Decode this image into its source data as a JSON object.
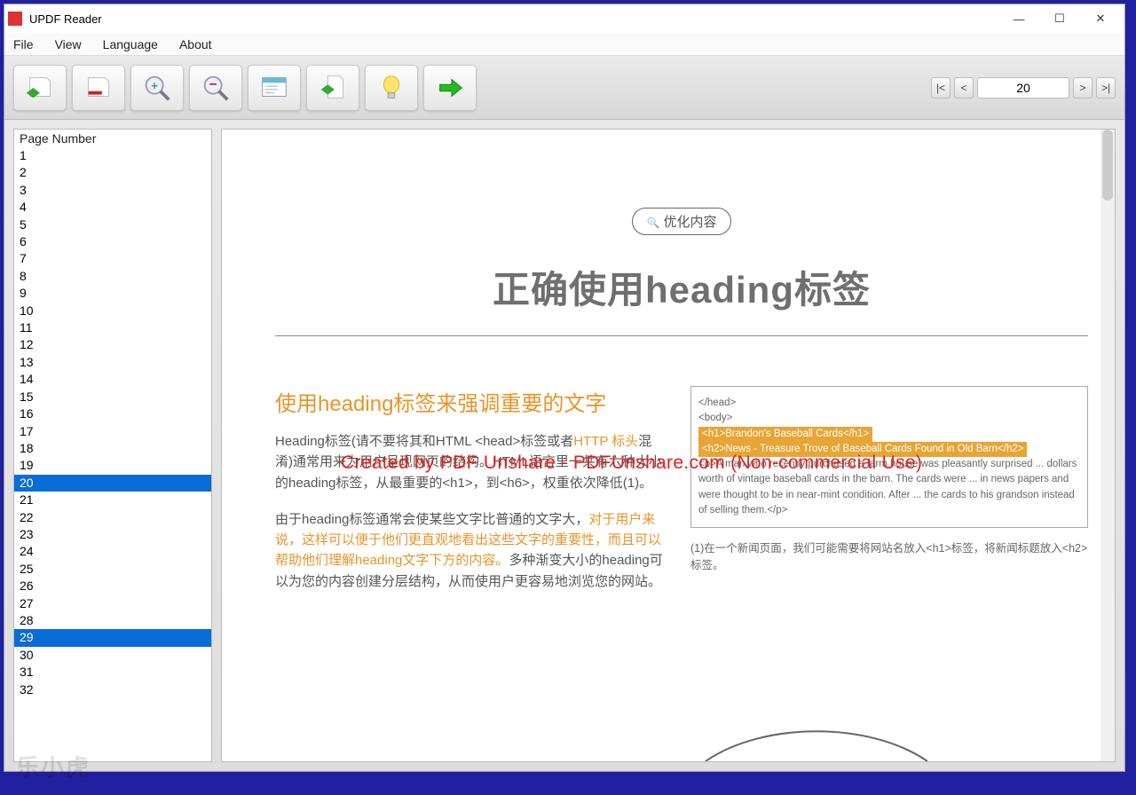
{
  "app": {
    "title": "UPDF Reader"
  },
  "menu": {
    "file": "File",
    "view": "View",
    "language": "Language",
    "about": "About"
  },
  "nav": {
    "first": "|<",
    "prev": "<",
    "page": "20",
    "next": ">",
    "last": ">|"
  },
  "sidebar": {
    "header": "Page Number",
    "items": [
      "1",
      "2",
      "3",
      "4",
      "5",
      "6",
      "7",
      "8",
      "9",
      "10",
      "11",
      "12",
      "13",
      "14",
      "15",
      "16",
      "17",
      "18",
      "19",
      "20",
      "21",
      "22",
      "23",
      "24",
      "25",
      "26",
      "27",
      "28",
      "29",
      "30",
      "31",
      "32"
    ],
    "selected": [
      "20",
      "29"
    ]
  },
  "content": {
    "pill": "优化内容",
    "hero": "正确使用heading标签",
    "section_title": "使用heading标签来强调重要的文字",
    "watermark": "Created by PDF Unshare - PDFUnshare.com (Non-commercial Use)",
    "p1a": "Heading标签(请不要将其和HTML <head>标签或者",
    "p1hl": "HTTP 标头",
    "p1b": "混淆)通常用来为用户呈现网页的结构。HTML语言里一共有六种大小的heading标签，从最重要的<h1>，到<h6>，权重依次降低(1)。",
    "p2a": "由于heading标签通常会使某些文字比普通的文字大，",
    "p2hl": "对于用户来说，这样可以便于他们更直观地看出这些文字的重要性，而且可以帮助他们理解heading文字下方的内容。",
    "p2b": "多种渐变大小的heading可以为您的内容创建分层结构，从而使用户更容易地浏览您的网站。",
    "code": {
      "head": "</head>",
      "body": "<body>",
      "h1": "<h1>Brandon's Baseball Cards</h1>",
      "h2": "<h2>News - Treasure Trove of Baseball Cards Found in Old Barn</h2>",
      "p": "<p>A man who recently purchased a farm house was pleasantly surprised ... dollars worth of vintage baseball cards in the barn. The cards were ... in news papers and were thought to be in near-mint condition. After ... the cards to his grandson instead of selling them.</p>"
    },
    "caption": "(1)在一个新闻页面，我们可能需要将网站名放入<h1>标签，将新闻标题放入<h2>标签。"
  },
  "corner_wm": "乐小虎"
}
